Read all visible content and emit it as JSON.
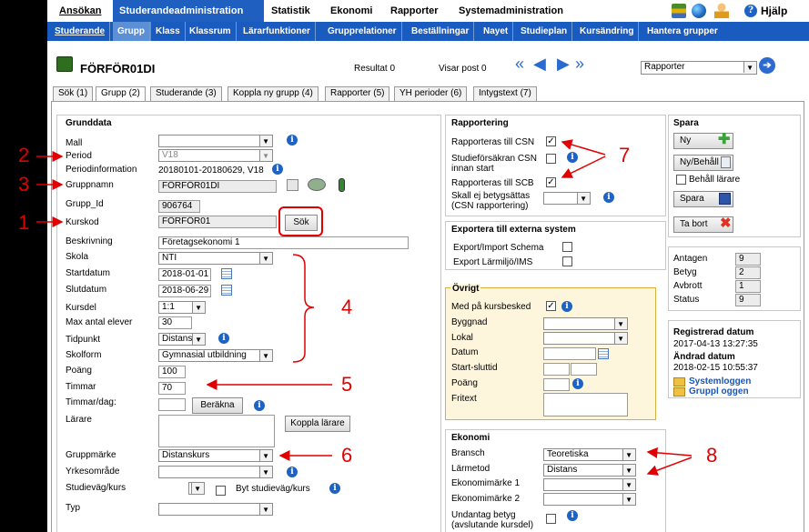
{
  "main_menu": [
    "Ansökan",
    "Studerandeadministration",
    "Statistik",
    "Ekonomi",
    "Rapporter",
    "Systemadministration"
  ],
  "help_label": "Hjälp",
  "sub_menu": [
    "Studerande",
    "Grupp",
    "Klass",
    "Klassrum",
    "Lärarfunktioner",
    "Grupprelationer",
    "Beställningar",
    "Nayet",
    "Studieplan",
    "Kursändring",
    "Hantera grupper"
  ],
  "header": {
    "title": "FÖRFÖR01DI",
    "result_label": "Resultat 0",
    "visar_label": "Visar post 0",
    "report_select": "Rapporter"
  },
  "tabs": [
    "Sök (1)",
    "Grupp (2)",
    "Studerande (3)",
    "Koppla ny grupp (4)",
    "Rapporter (5)",
    "YH perioder (6)",
    "Intygstext (7)"
  ],
  "grunddata": {
    "title": "Grunddata",
    "labels": {
      "mall": "Mall",
      "period": "Period",
      "periodinfo": "Periodinformation",
      "gruppnamn": "Gruppnamn",
      "grupp_id": "Grupp_Id",
      "kurskod": "Kurskod",
      "beskrivning": "Beskrivning",
      "skola": "Skola",
      "startdatum": "Startdatum",
      "slutdatum": "Slutdatum",
      "kursdel": "Kursdel",
      "max_elever": "Max antal elever",
      "tidpunkt": "Tidpunkt",
      "skolform": "Skolform",
      "poang": "Poäng",
      "timmar": "Timmar",
      "timmar_dag": "Timmar/dag:",
      "larare": "Lärare",
      "gruppmarke": "Gruppmärke",
      "yrkesomrade": "Yrkesområde",
      "studievag": "Studieväg/kurs",
      "typ": "Typ"
    },
    "values": {
      "period": "V18",
      "periodinfo": "20180101-20180629, V18",
      "gruppnamn": "FÖRFÖR01DI",
      "grupp_id": "906764",
      "kurskod": "FÖRFÖR01",
      "beskrivning": "Företagsekonomi 1",
      "skola": "NTI",
      "startdatum": "2018-01-01",
      "slutdatum": "2018-06-29",
      "kursdel": "1:1",
      "max_elever": "30",
      "tidpunkt": "Distans",
      "skolform": "Gymnasial utbildning",
      "poang": "100",
      "timmar": "70",
      "gruppmarke": "Distanskurs"
    },
    "buttons": {
      "sok": "Sök",
      "berakna": "Beräkna",
      "koppla_larare": "Koppla lärare",
      "byt_studievag": "Byt studieväg/kurs"
    }
  },
  "rapportering": {
    "title": "Rapportering",
    "csn": "Rapporteras till CSN",
    "studieforsakran": "Studieförsäkran CSN innan start",
    "scb": "Rapporteras till SCB",
    "betyg": "Skall ej betygsättas (CSN rapportering)"
  },
  "export": {
    "title": "Exportera till externa system",
    "schema": "Export/Import Schema",
    "larmiljo": "Export Lärmiljö/IMS"
  },
  "ovrigt": {
    "title": "Övrigt",
    "kursbesked": "Med på kursbesked",
    "byggnad": "Byggnad",
    "lokal": "Lokal",
    "datum": "Datum",
    "start_slut": "Start-sluttid",
    "poang": "Poäng",
    "fritext": "Fritext"
  },
  "ekonomi": {
    "title": "Ekonomi",
    "bransch": "Bransch",
    "larmetod": "Lärmetod",
    "em1": "Ekonomimärke 1",
    "em2": "Ekonomimärke 2",
    "undantag": "Undantag betyg (avslutande kursdel)",
    "bransch_value": "Teoretiska",
    "larmetod_value": "Distans"
  },
  "spara": {
    "title": "Spara",
    "ny": "Ny",
    "ny_behall": "Ny/Behåll",
    "behall_larare": "Behåll lärare",
    "spara": "Spara",
    "ta_bort": "Ta bort"
  },
  "stats": {
    "antagen_label": "Antagen",
    "antagen": "9",
    "betyg_label": "Betyg",
    "betyg": "2",
    "avbrott_label": "Avbrott",
    "avbrott": "1",
    "status_label": "Status",
    "status": "9"
  },
  "registered": {
    "reg_label": "Registrerad datum",
    "reg_date": "2017-04-13 13:27:35",
    "mod_label": "Ändrad datum",
    "mod_date": "2018-02-15 10:55:37",
    "syslog": "Systemloggen",
    "grouplog": "Gruppl oggen"
  },
  "annotations": [
    "1",
    "2",
    "3",
    "4",
    "5",
    "6",
    "7",
    "8"
  ],
  "colors": {
    "menu_active": "#1f5fbf",
    "submenu": "#1a5bbf",
    "annotation": "#e00000"
  }
}
